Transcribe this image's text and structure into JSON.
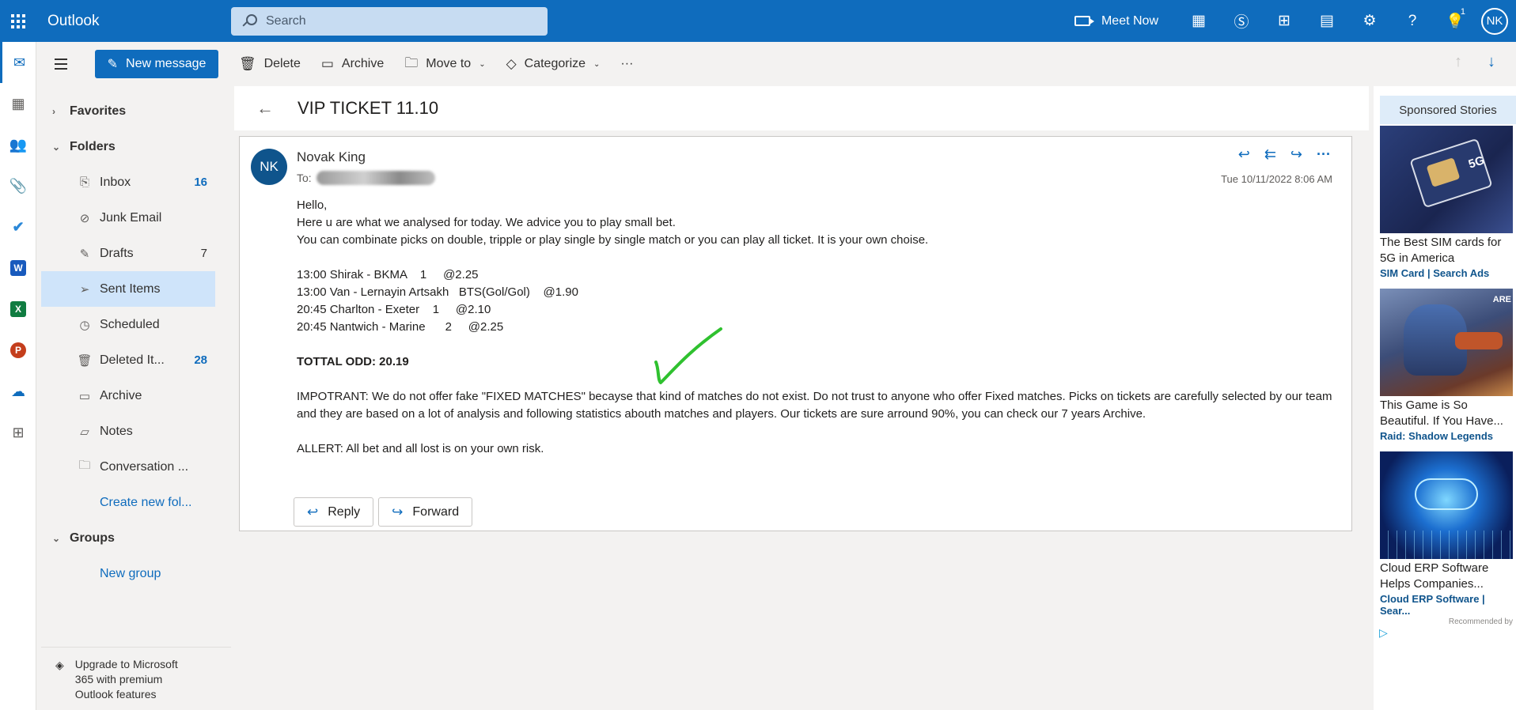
{
  "topbar": {
    "app_name": "Outlook",
    "search_placeholder": "Search",
    "meet_now": "Meet Now",
    "notification_count": "1",
    "user_initials": "NK"
  },
  "commands": {
    "new_message": "New message",
    "delete": "Delete",
    "archive": "Archive",
    "move_to": "Move to",
    "categorize": "Categorize",
    "more": "···"
  },
  "folders": {
    "favorites": "Favorites",
    "folders_header": "Folders",
    "items": [
      {
        "label": "Inbox",
        "count": "16"
      },
      {
        "label": "Junk Email",
        "count": ""
      },
      {
        "label": "Drafts",
        "count": "7"
      },
      {
        "label": "Sent Items",
        "count": ""
      },
      {
        "label": "Scheduled",
        "count": ""
      },
      {
        "label": "Deleted It...",
        "count": "28"
      },
      {
        "label": "Archive",
        "count": ""
      },
      {
        "label": "Notes",
        "count": ""
      },
      {
        "label": "Conversation ...",
        "count": ""
      }
    ],
    "create_new_folder": "Create new fol...",
    "groups_header": "Groups",
    "new_group": "New group",
    "upgrade_text": "Upgrade to Microsoft 365 with premium Outlook features"
  },
  "message": {
    "subject": "VIP TICKET 11.10",
    "sender_initials": "NK",
    "sender_name": "Novak King",
    "to_label": "To:",
    "date": "Tue 10/11/2022 8:06 AM",
    "greeting": "Hello,",
    "line1": "Here u are what we analysed for today. We advice you to play small bet.",
    "line2": "You can combinate picks on double, tripple or play single by single match or you can play all ticket. It is your own choise.",
    "picks": [
      "13:00 Shirak - BKMA    1     @2.25",
      "13:00 Van - Lernayin Artsakh   BTS(Gol/Gol)    @1.90",
      "20:45 Charlton - Exeter    1     @2.10",
      "20:45 Nantwich - Marine      2     @2.25"
    ],
    "total_odd": "TOTTAL ODD: 20.19",
    "important": "IMPOTRANT: We do not offer fake \"FIXED MATCHES\" becayse that kind of matches do not exist. Do not trust to anyone who offer Fixed matches. Picks on tickets are carefully selected by our team and they are based on a lot of analysis and following statistics abouth matches and players. Our tickets are sure arround 90%, you can check our 7 years Archive.",
    "alert": "ALLERT: All bet and all lost is on your own risk.",
    "reply": "Reply",
    "forward": "Forward"
  },
  "ads": {
    "header": "Sponsored Stories",
    "items": [
      {
        "title": "The Best SIM cards for 5G in America",
        "source": "SIM Card | Search Ads",
        "badge": "5G"
      },
      {
        "title": "This Game is So Beautiful. If You Have...",
        "source": "Raid: Shadow Legends",
        "badge": "ARE"
      },
      {
        "title": "Cloud ERP Software Helps Companies...",
        "source": "Cloud ERP Software | Sear...",
        "badge": ""
      }
    ],
    "recommended": "Recommended by"
  },
  "colors": {
    "brand": "#0f6cbd",
    "selected_folder": "#cfe4fa",
    "checkmark": "#2fc12f"
  }
}
